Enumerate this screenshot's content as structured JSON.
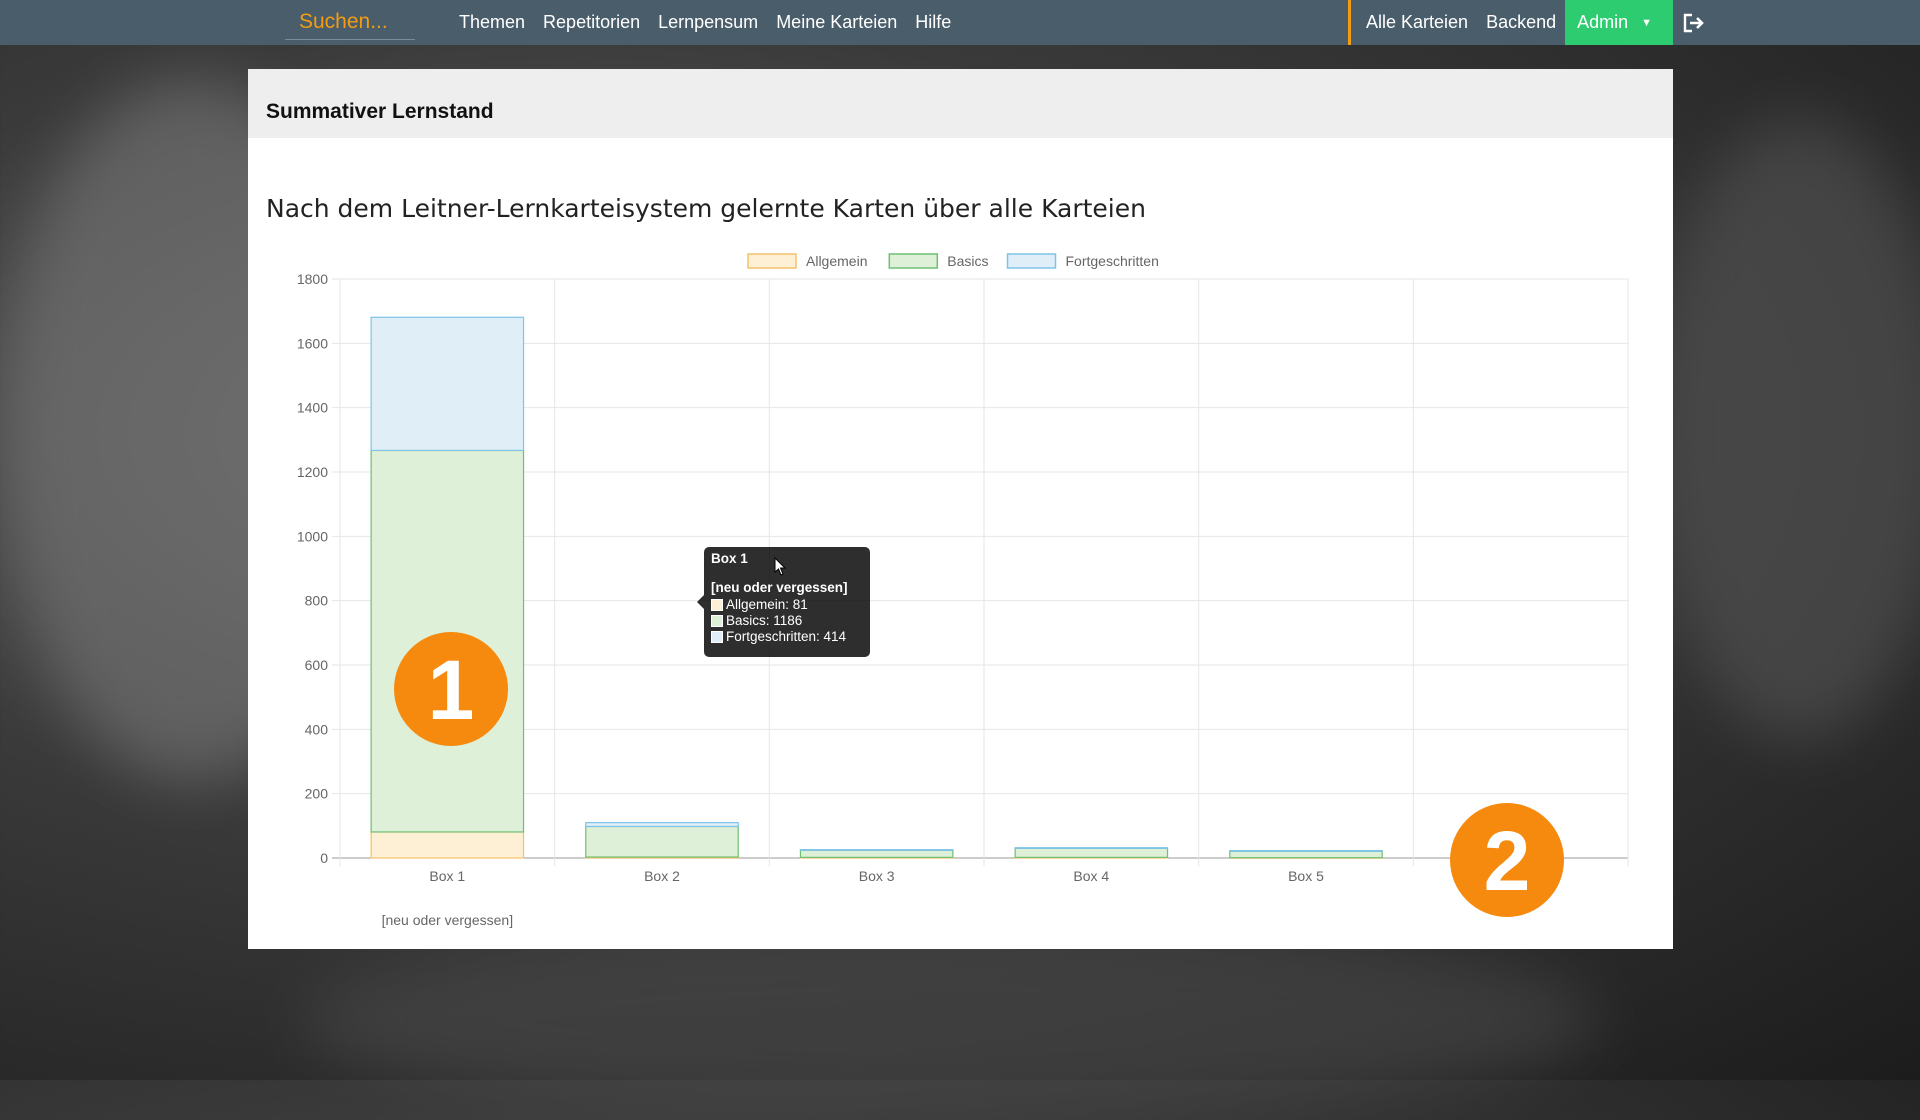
{
  "nav": {
    "search_placeholder": "Suchen...",
    "items": [
      "Themen",
      "Repetitorien",
      "Lernpensum",
      "Meine Karteien",
      "Hilfe"
    ],
    "right_items": [
      "Alle Karteien",
      "Backend"
    ],
    "admin_label": "Admin",
    "logout_icon": "logout-icon",
    "accent_color": "#f39c12",
    "admin_color": "#2ecc71"
  },
  "panel": {
    "title": "Summativer Lernstand",
    "subtitle": "Nach dem Leitner-Lernkarteisystem gelernte Karten über alle Karteien"
  },
  "chart_data": {
    "type": "bar",
    "stacked": true,
    "categories": [
      "Box 1",
      "Box 2",
      "Box 3",
      "Box 4",
      "Box 5",
      ""
    ],
    "category_sublabels": [
      "[neu oder vergessen]",
      "",
      "",
      "",
      "",
      ""
    ],
    "series": [
      {
        "name": "Allgemein",
        "values": [
          81,
          3,
          2,
          2,
          1,
          0
        ],
        "fill": "#fdf0d5",
        "stroke": "#f5c26b"
      },
      {
        "name": "Basics",
        "values": [
          1186,
          95,
          22,
          28,
          20,
          0
        ],
        "fill": "#dff0d8",
        "stroke": "#6fbf73"
      },
      {
        "name": "Fortgeschritten",
        "values": [
          414,
          12,
          2,
          2,
          2,
          0
        ],
        "fill": "#dfeef7",
        "stroke": "#7fc4e8"
      }
    ],
    "ylim": [
      0,
      1800
    ],
    "yticks": [
      0,
      200,
      400,
      600,
      800,
      1000,
      1200,
      1400,
      1600,
      1800
    ],
    "legend_position": "top",
    "grid": true
  },
  "tooltip": {
    "title": "Box 1",
    "sub": "[neu oder vergessen]",
    "rows": [
      {
        "label": "Allgemein: 81",
        "color": "#fdf0d5"
      },
      {
        "label": "Basics: 1186",
        "color": "#dff0d8"
      },
      {
        "label": "Fortgeschritten: 414",
        "color": "#dfeef7"
      }
    ]
  },
  "badges": [
    "1",
    "2"
  ]
}
